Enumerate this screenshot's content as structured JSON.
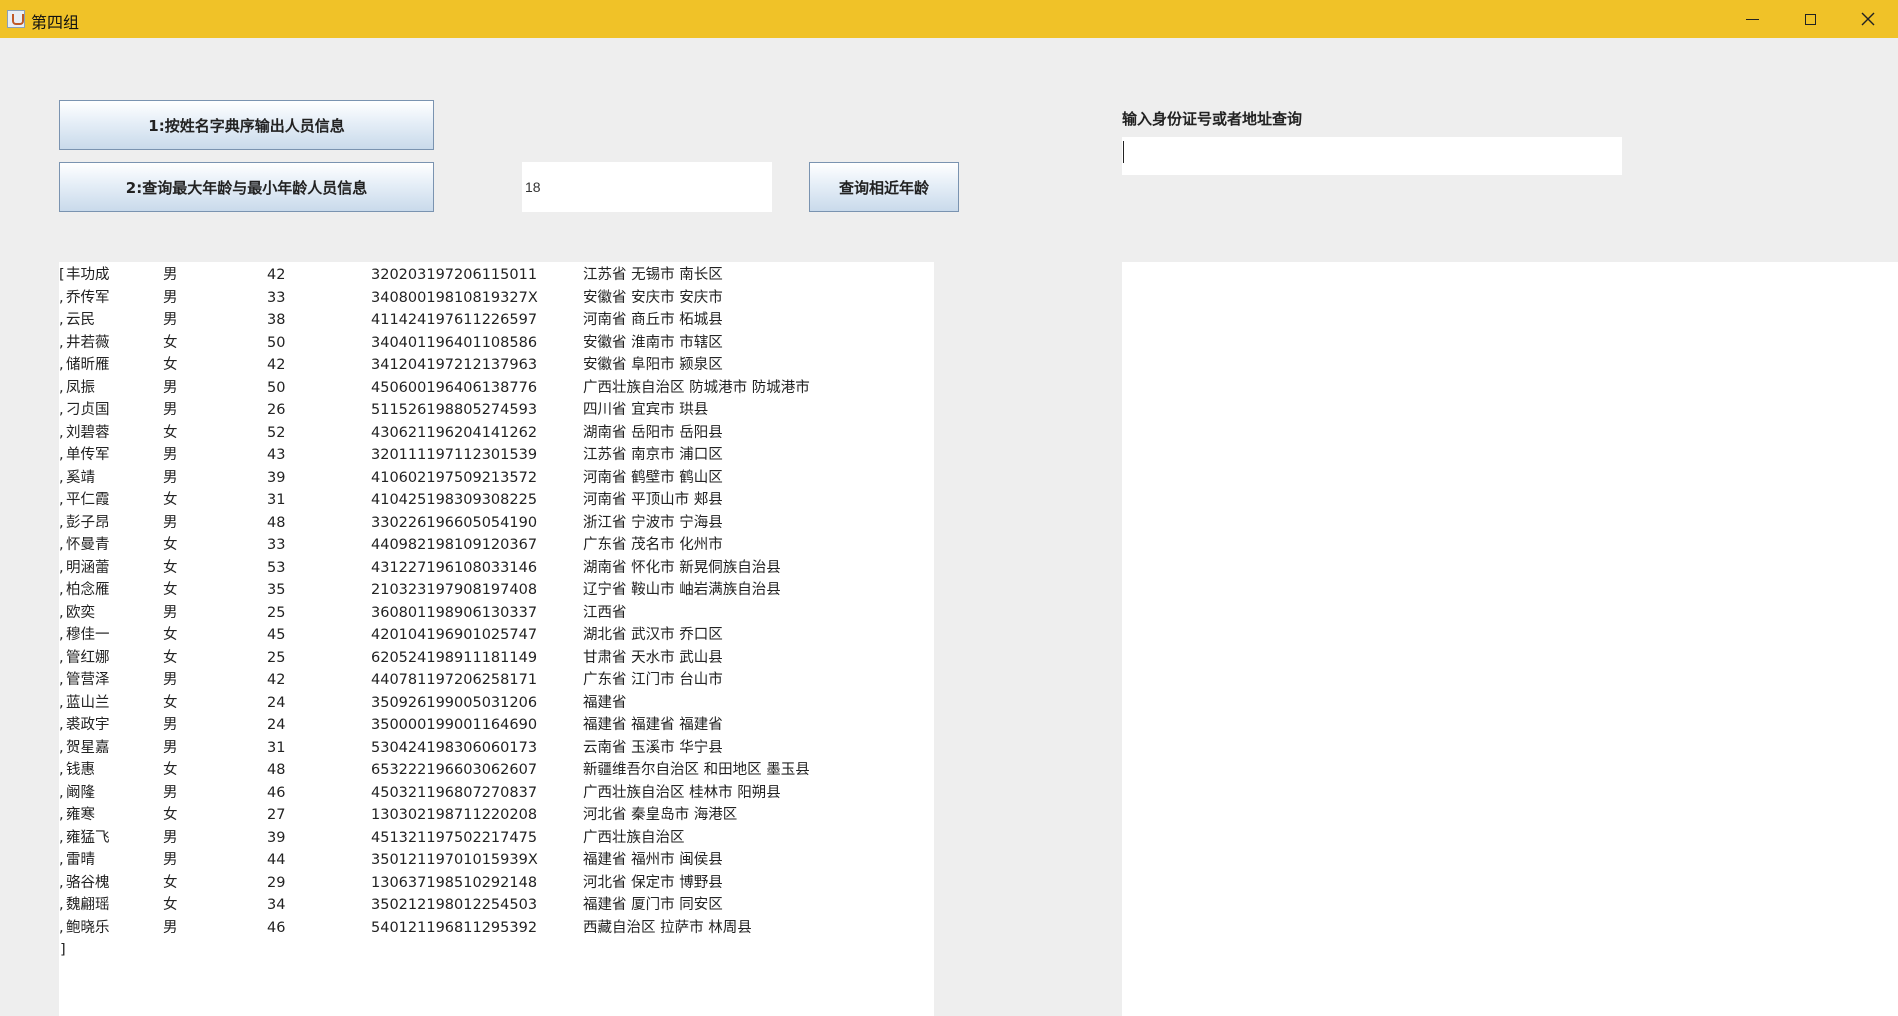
{
  "window": {
    "title": "第四组"
  },
  "buttons": {
    "sort_by_name": "1:按姓名字典序输出人员信息",
    "query_max_min_age": "2:查询最大年龄与最小年龄人员信息",
    "query_near_age": "查询相近年龄"
  },
  "age_input": {
    "value": "18"
  },
  "id_query": {
    "label": "输入身份证号或者地址查询",
    "value": ""
  },
  "results": {
    "open_bracket": "[",
    "separator": ",",
    "close_bracket": "]",
    "rows": [
      {
        "name": "丰功成",
        "gender": "男",
        "age": "42",
        "id": "320203197206115011",
        "address": "江苏省 无锡市 南长区"
      },
      {
        "name": "乔传军",
        "gender": "男",
        "age": "33",
        "id": "34080019810819327X",
        "address": "安徽省 安庆市 安庆市"
      },
      {
        "name": "云民",
        "gender": "男",
        "age": "38",
        "id": "411424197611226597",
        "address": "河南省 商丘市 柘城县"
      },
      {
        "name": "井若薇",
        "gender": "女",
        "age": "50",
        "id": "340401196401108586",
        "address": "安徽省 淮南市 市辖区"
      },
      {
        "name": "储昕雁",
        "gender": "女",
        "age": "42",
        "id": "341204197212137963",
        "address": "安徽省 阜阳市 颍泉区"
      },
      {
        "name": "凤振",
        "gender": "男",
        "age": "50",
        "id": "450600196406138776",
        "address": "广西壮族自治区 防城港市 防城港市"
      },
      {
        "name": "刁贞国",
        "gender": "男",
        "age": "26",
        "id": "511526198805274593",
        "address": "四川省 宜宾市 珙县"
      },
      {
        "name": "刘碧蓉",
        "gender": "女",
        "age": "52",
        "id": "430621196204141262",
        "address": "湖南省 岳阳市 岳阳县"
      },
      {
        "name": "单传军",
        "gender": "男",
        "age": "43",
        "id": "320111197112301539",
        "address": "江苏省 南京市 浦口区"
      },
      {
        "name": "奚靖",
        "gender": "男",
        "age": "39",
        "id": "410602197509213572",
        "address": "河南省 鹤壁市 鹤山区"
      },
      {
        "name": "平仁霞",
        "gender": "女",
        "age": "31",
        "id": "410425198309308225",
        "address": "河南省 平顶山市 郏县"
      },
      {
        "name": "彭子昂",
        "gender": "男",
        "age": "48",
        "id": "330226196605054190",
        "address": "浙江省 宁波市 宁海县"
      },
      {
        "name": "怀曼青",
        "gender": "女",
        "age": "33",
        "id": "440982198109120367",
        "address": "广东省 茂名市 化州市"
      },
      {
        "name": "明涵蕾",
        "gender": "女",
        "age": "53",
        "id": "431227196108033146",
        "address": "湖南省 怀化市 新晃侗族自治县"
      },
      {
        "name": "柏念雁",
        "gender": "女",
        "age": "35",
        "id": "210323197908197408",
        "address": "辽宁省 鞍山市 岫岩满族自治县"
      },
      {
        "name": "欧奕",
        "gender": "男",
        "age": "25",
        "id": "360801198906130337",
        "address": "江西省"
      },
      {
        "name": "穆佳一",
        "gender": "女",
        "age": "45",
        "id": "420104196901025747",
        "address": "湖北省 武汉市 乔口区"
      },
      {
        "name": "管红娜",
        "gender": "女",
        "age": "25",
        "id": "620524198911181149",
        "address": "甘肃省 天水市 武山县"
      },
      {
        "name": "管营泽",
        "gender": "男",
        "age": "42",
        "id": "440781197206258171",
        "address": "广东省 江门市 台山市"
      },
      {
        "name": "蓝山兰",
        "gender": "女",
        "age": "24",
        "id": "350926199005031206",
        "address": "福建省"
      },
      {
        "name": "裘政宇",
        "gender": "男",
        "age": "24",
        "id": "350000199001164690",
        "address": "福建省 福建省 福建省"
      },
      {
        "name": "贺星嘉",
        "gender": "男",
        "age": "31",
        "id": "530424198306060173",
        "address": "云南省 玉溪市 华宁县"
      },
      {
        "name": "钱惠",
        "gender": "女",
        "age": "48",
        "id": "653222196603062607",
        "address": "新疆维吾尔自治区 和田地区 墨玉县"
      },
      {
        "name": "阚隆",
        "gender": "男",
        "age": "46",
        "id": "450321196807270837",
        "address": "广西壮族自治区 桂林市 阳朔县"
      },
      {
        "name": "雍寒",
        "gender": "女",
        "age": "27",
        "id": "130302198711220208",
        "address": "河北省 秦皇岛市 海港区"
      },
      {
        "name": "雍猛飞",
        "gender": "男",
        "age": "39",
        "id": "451321197502217475",
        "address": "广西壮族自治区"
      },
      {
        "name": "雷晴",
        "gender": "男",
        "age": "44",
        "id": "35012119701015939X",
        "address": "福建省 福州市 闽侯县"
      },
      {
        "name": "骆谷槐",
        "gender": "女",
        "age": "29",
        "id": "130637198510292148",
        "address": "河北省 保定市 博野县"
      },
      {
        "name": "魏翩瑶",
        "gender": "女",
        "age": "34",
        "id": "350212198012254503",
        "address": "福建省 厦门市 同安区"
      },
      {
        "name": "鲍晓乐",
        "gender": "男",
        "age": "46",
        "id": "540121196811295392",
        "address": "西藏自治区 拉萨市 林周县"
      }
    ]
  }
}
